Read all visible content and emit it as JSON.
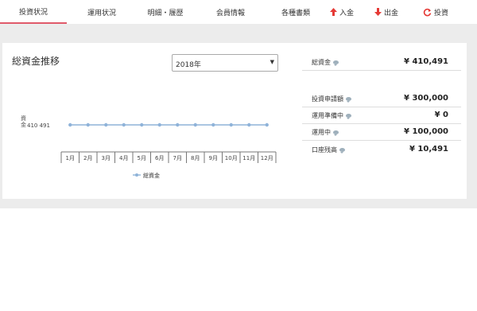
{
  "nav": {
    "tabs": [
      {
        "label": "投資状況"
      },
      {
        "label": "運用状況"
      },
      {
        "label": "明細・履歴"
      },
      {
        "label": "会員情報"
      },
      {
        "label": "各種書類"
      },
      {
        "label": "入金"
      },
      {
        "label": "出金"
      },
      {
        "label": "投資"
      }
    ]
  },
  "panel": {
    "title": "総資金推移",
    "year_select": "2018年"
  },
  "summary": {
    "total": {
      "label": "総資金",
      "value": "¥ 410,491"
    },
    "rows": [
      {
        "label": "投資申請額",
        "value": "¥ 300,000"
      },
      {
        "label": "運用準備中",
        "value": "¥ 0"
      },
      {
        "label": "運用中",
        "value": "¥ 100,000"
      },
      {
        "label": "口座残高",
        "value": "¥ 10,491"
      }
    ]
  },
  "chart_data": {
    "type": "line",
    "ylabel": "資金",
    "ytick": "410 491",
    "categories": [
      "1月",
      "2月",
      "3月",
      "4月",
      "5月",
      "6月",
      "7月",
      "8月",
      "9月",
      "10月",
      "11月",
      "12月"
    ],
    "series": [
      {
        "name": "総資金",
        "values": [
          410491,
          410491,
          410491,
          410491,
          410491,
          410491,
          410491,
          410491,
          410491,
          410491,
          410491,
          410491
        ]
      }
    ],
    "legend": "bottom",
    "color": "#8fb3d9"
  }
}
